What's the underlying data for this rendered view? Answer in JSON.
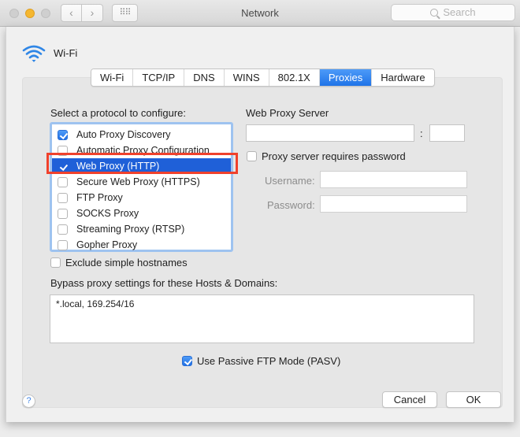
{
  "window": {
    "title": "Network",
    "search_placeholder": "Search",
    "back_glyph": "‹",
    "forward_glyph": "›",
    "grid_glyph": "⠿⠿",
    "icons": [
      "close-button",
      "minimize-button",
      "zoom-button",
      "back-icon",
      "forward-icon",
      "grid-icon",
      "search-icon"
    ]
  },
  "interface": {
    "name": "Wi-Fi",
    "icon": "wifi-icon",
    "accent_color": "#2f86e6"
  },
  "tabs": [
    {
      "label": "Wi-Fi",
      "active": false
    },
    {
      "label": "TCP/IP",
      "active": false
    },
    {
      "label": "DNS",
      "active": false
    },
    {
      "label": "WINS",
      "active": false
    },
    {
      "label": "802.1X",
      "active": false
    },
    {
      "label": "Proxies",
      "active": true
    },
    {
      "label": "Hardware",
      "active": false
    }
  ],
  "protocols": {
    "heading": "Select a protocol to configure:",
    "items": [
      {
        "label": "Auto Proxy Discovery",
        "checked": true,
        "selected": false
      },
      {
        "label": "Automatic Proxy Configuration",
        "checked": false,
        "selected": false
      },
      {
        "label": "Web Proxy (HTTP)",
        "checked": true,
        "selected": true
      },
      {
        "label": "Secure Web Proxy (HTTPS)",
        "checked": false,
        "selected": false
      },
      {
        "label": "FTP Proxy",
        "checked": false,
        "selected": false
      },
      {
        "label": "SOCKS Proxy",
        "checked": false,
        "selected": false
      },
      {
        "label": "Streaming Proxy (RTSP)",
        "checked": false,
        "selected": false
      },
      {
        "label": "Gopher Proxy",
        "checked": false,
        "selected": false
      }
    ],
    "highlight_color": "#f0412c"
  },
  "exclude_simple": {
    "label": "Exclude simple hostnames",
    "checked": false
  },
  "server": {
    "heading": "Web Proxy Server",
    "host_value": "",
    "port_separator": ":",
    "port_value": "",
    "requires_password": {
      "label": "Proxy server requires password",
      "checked": false
    },
    "username_label": "Username:",
    "username_value": "",
    "password_label": "Password:",
    "password_value": ""
  },
  "bypass": {
    "label": "Bypass proxy settings for these Hosts & Domains:",
    "value": "*.local, 169.254/16"
  },
  "passive_ftp": {
    "label": "Use Passive FTP Mode (PASV)",
    "checked": true
  },
  "footer": {
    "help_glyph": "?",
    "cancel_label": "Cancel",
    "ok_label": "OK"
  }
}
